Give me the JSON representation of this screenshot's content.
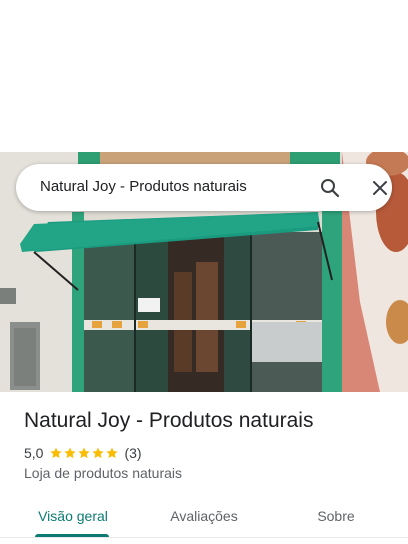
{
  "search": {
    "query": "Natural Joy - Produtos naturais"
  },
  "icons": {
    "search": "search-icon",
    "close": "close-icon",
    "star": "star-icon"
  },
  "place": {
    "title": "Natural Joy - Produtos naturais",
    "rating": "5,0",
    "stars": 5,
    "review_count": "(3)",
    "category": "Loja de produtos naturais"
  },
  "tabs": [
    {
      "label": "Visão geral",
      "selected": true
    },
    {
      "label": "Avaliações",
      "selected": false
    },
    {
      "label": "Sobre",
      "selected": false
    }
  ],
  "colors": {
    "accent": "#0b7b72",
    "star": "#fbbc04",
    "awning": "#1a9b80"
  }
}
